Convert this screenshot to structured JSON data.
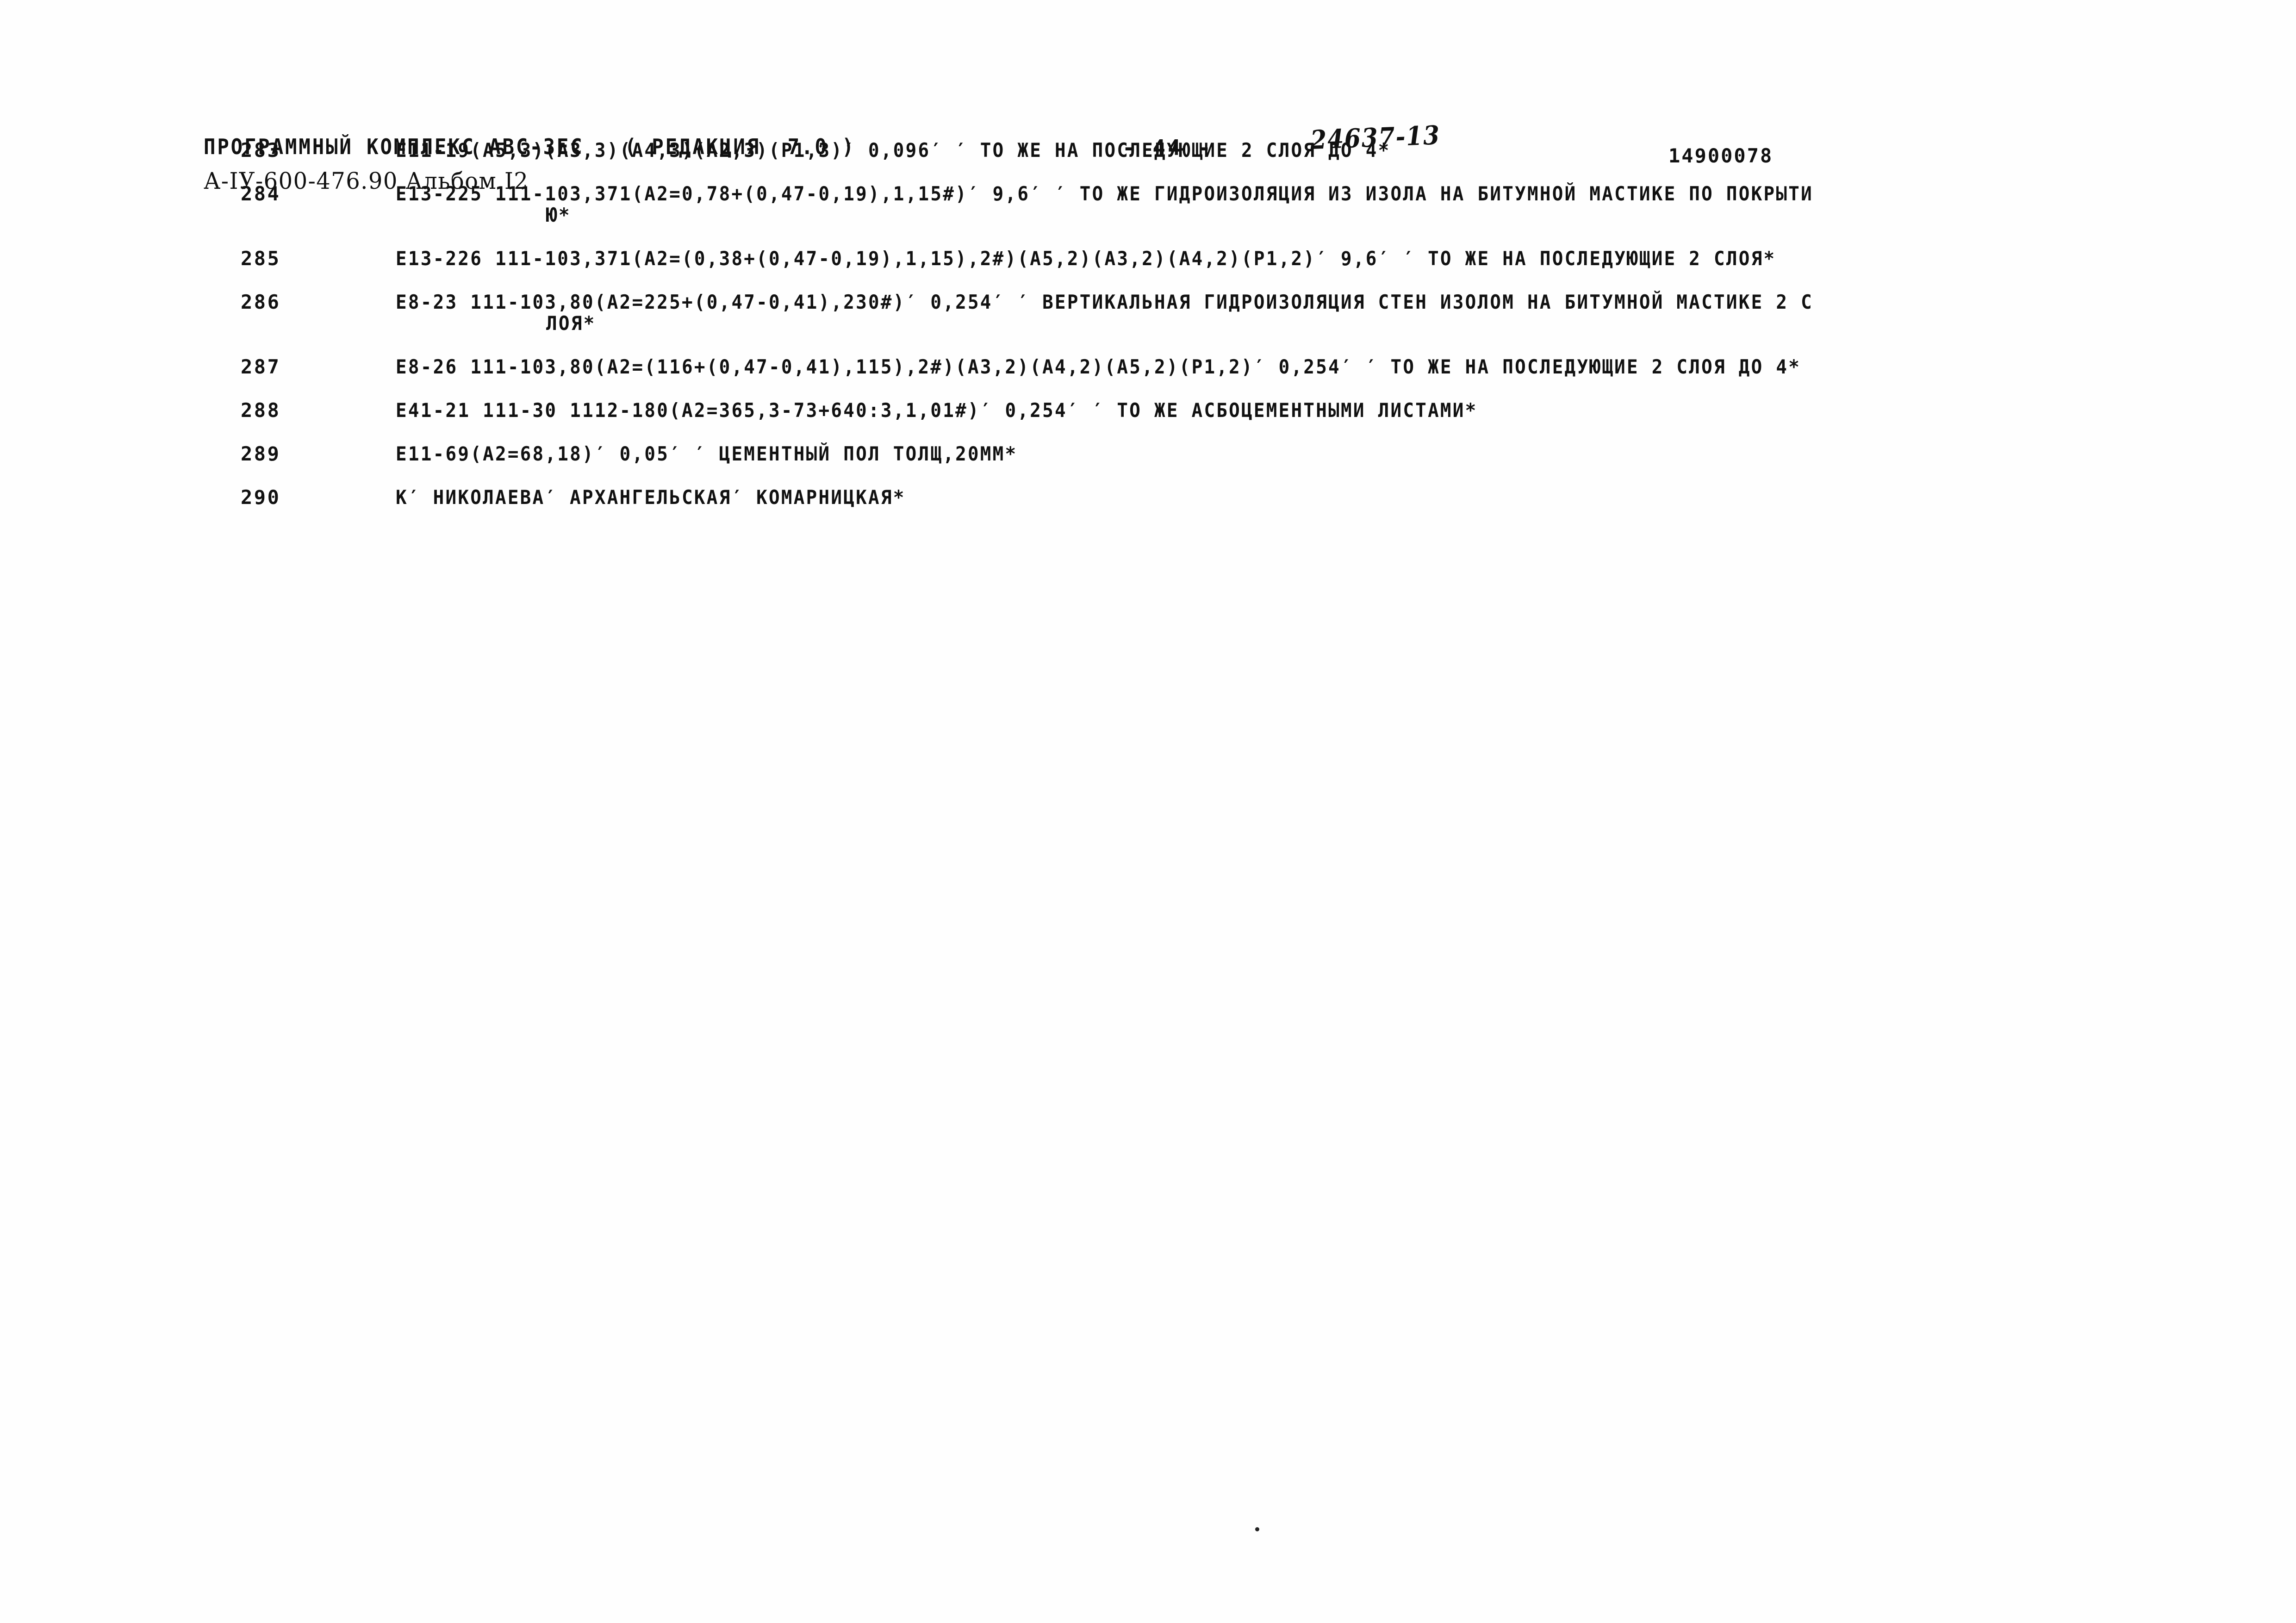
{
  "header": {
    "program_title": "ПРОГРАММНЫЙ КОМПЛЕКС АВС-ЗЕС   ( РЕДАКЦИЯ  7.0 )",
    "document_code": "А-IУ-600-476.90 Альбом I2",
    "page_number": "- 44 -",
    "handwritten_note": "24637-13",
    "document_id": "14900078"
  },
  "listing": {
    "rows": [
      {
        "num": "283",
        "text": "Е11-19(А5,3)(А3,3)(А4,3)(А2,3)(Р1,3)′ 0,096′ ′ ТО ЖЕ НА ПОСЛЕДУЮЩИЕ 2 СЛОЯ ДО 4*",
        "cont": ""
      },
      {
        "num": "284",
        "text": "Е13-225 111-103,371(А2=0,78+(0,47-0,19),1,15#)′ 9,6′ ′ ТО ЖЕ ГИДРОИЗОЛЯЦИЯ ИЗ ИЗОЛА НА БИТУМНОЙ МАСТИКЕ ПО ПОКРЫТИ",
        "cont": "Ю*"
      },
      {
        "num": "285",
        "text": "Е13-226 111-103,371(А2=(0,38+(0,47-0,19),1,15),2#)(А5,2)(А3,2)(А4,2)(Р1,2)′ 9,6′ ′ ТО ЖЕ НА ПОСЛЕДУЮЩИЕ 2 СЛОЯ*",
        "cont": ""
      },
      {
        "num": "286",
        "text": "Е8-23 111-103,80(А2=225+(0,47-0,41),230#)′ 0,254′ ′ ВЕРТИКАЛЬНАЯ ГИДРОИЗОЛЯЦИЯ СТЕН ИЗОЛОМ НА БИТУМНОЙ МАСТИКЕ 2 С",
        "cont": "ЛОЯ*"
      },
      {
        "num": "287",
        "text": "Е8-26 111-103,80(А2=(116+(0,47-0,41),115),2#)(А3,2)(А4,2)(А5,2)(Р1,2)′ 0,254′ ′ ТО ЖЕ НА ПОСЛЕДУЮЩИЕ 2 СЛОЯ ДО 4*",
        "cont": ""
      },
      {
        "num": "288",
        "text": "Е41-21 111-30 1112-180(А2=365,3-73+640:3,1,01#)′ 0,254′ ′ ТО ЖЕ АСБОЦЕМЕНТНЫМИ ЛИСТАМИ*",
        "cont": ""
      },
      {
        "num": "289",
        "text": "Е11-69(А2=68,18)′ 0,05′ ′ ЦЕМЕНТНЫЙ ПОЛ ТОЛЩ,20ММ*",
        "cont": ""
      },
      {
        "num": "290",
        "text": "К′ НИКОЛАЕВА′ АРХАНГЕЛЬСКАЯ′ КОМАРНИЦКАЯ*",
        "cont": ""
      }
    ]
  }
}
